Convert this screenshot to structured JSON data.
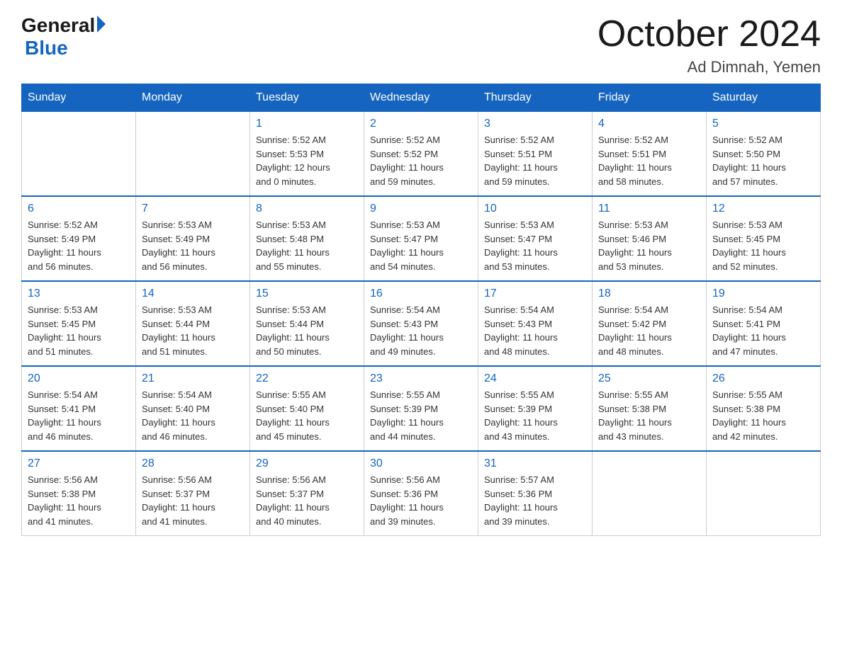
{
  "header": {
    "logo_general": "General",
    "logo_blue": "Blue",
    "month_title": "October 2024",
    "location": "Ad Dimnah, Yemen"
  },
  "weekdays": [
    "Sunday",
    "Monday",
    "Tuesday",
    "Wednesday",
    "Thursday",
    "Friday",
    "Saturday"
  ],
  "weeks": [
    [
      {
        "day": "",
        "info": ""
      },
      {
        "day": "",
        "info": ""
      },
      {
        "day": "1",
        "info": "Sunrise: 5:52 AM\nSunset: 5:53 PM\nDaylight: 12 hours\nand 0 minutes."
      },
      {
        "day": "2",
        "info": "Sunrise: 5:52 AM\nSunset: 5:52 PM\nDaylight: 11 hours\nand 59 minutes."
      },
      {
        "day": "3",
        "info": "Sunrise: 5:52 AM\nSunset: 5:51 PM\nDaylight: 11 hours\nand 59 minutes."
      },
      {
        "day": "4",
        "info": "Sunrise: 5:52 AM\nSunset: 5:51 PM\nDaylight: 11 hours\nand 58 minutes."
      },
      {
        "day": "5",
        "info": "Sunrise: 5:52 AM\nSunset: 5:50 PM\nDaylight: 11 hours\nand 57 minutes."
      }
    ],
    [
      {
        "day": "6",
        "info": "Sunrise: 5:52 AM\nSunset: 5:49 PM\nDaylight: 11 hours\nand 56 minutes."
      },
      {
        "day": "7",
        "info": "Sunrise: 5:53 AM\nSunset: 5:49 PM\nDaylight: 11 hours\nand 56 minutes."
      },
      {
        "day": "8",
        "info": "Sunrise: 5:53 AM\nSunset: 5:48 PM\nDaylight: 11 hours\nand 55 minutes."
      },
      {
        "day": "9",
        "info": "Sunrise: 5:53 AM\nSunset: 5:47 PM\nDaylight: 11 hours\nand 54 minutes."
      },
      {
        "day": "10",
        "info": "Sunrise: 5:53 AM\nSunset: 5:47 PM\nDaylight: 11 hours\nand 53 minutes."
      },
      {
        "day": "11",
        "info": "Sunrise: 5:53 AM\nSunset: 5:46 PM\nDaylight: 11 hours\nand 53 minutes."
      },
      {
        "day": "12",
        "info": "Sunrise: 5:53 AM\nSunset: 5:45 PM\nDaylight: 11 hours\nand 52 minutes."
      }
    ],
    [
      {
        "day": "13",
        "info": "Sunrise: 5:53 AM\nSunset: 5:45 PM\nDaylight: 11 hours\nand 51 minutes."
      },
      {
        "day": "14",
        "info": "Sunrise: 5:53 AM\nSunset: 5:44 PM\nDaylight: 11 hours\nand 51 minutes."
      },
      {
        "day": "15",
        "info": "Sunrise: 5:53 AM\nSunset: 5:44 PM\nDaylight: 11 hours\nand 50 minutes."
      },
      {
        "day": "16",
        "info": "Sunrise: 5:54 AM\nSunset: 5:43 PM\nDaylight: 11 hours\nand 49 minutes."
      },
      {
        "day": "17",
        "info": "Sunrise: 5:54 AM\nSunset: 5:43 PM\nDaylight: 11 hours\nand 48 minutes."
      },
      {
        "day": "18",
        "info": "Sunrise: 5:54 AM\nSunset: 5:42 PM\nDaylight: 11 hours\nand 48 minutes."
      },
      {
        "day": "19",
        "info": "Sunrise: 5:54 AM\nSunset: 5:41 PM\nDaylight: 11 hours\nand 47 minutes."
      }
    ],
    [
      {
        "day": "20",
        "info": "Sunrise: 5:54 AM\nSunset: 5:41 PM\nDaylight: 11 hours\nand 46 minutes."
      },
      {
        "day": "21",
        "info": "Sunrise: 5:54 AM\nSunset: 5:40 PM\nDaylight: 11 hours\nand 46 minutes."
      },
      {
        "day": "22",
        "info": "Sunrise: 5:55 AM\nSunset: 5:40 PM\nDaylight: 11 hours\nand 45 minutes."
      },
      {
        "day": "23",
        "info": "Sunrise: 5:55 AM\nSunset: 5:39 PM\nDaylight: 11 hours\nand 44 minutes."
      },
      {
        "day": "24",
        "info": "Sunrise: 5:55 AM\nSunset: 5:39 PM\nDaylight: 11 hours\nand 43 minutes."
      },
      {
        "day": "25",
        "info": "Sunrise: 5:55 AM\nSunset: 5:38 PM\nDaylight: 11 hours\nand 43 minutes."
      },
      {
        "day": "26",
        "info": "Sunrise: 5:55 AM\nSunset: 5:38 PM\nDaylight: 11 hours\nand 42 minutes."
      }
    ],
    [
      {
        "day": "27",
        "info": "Sunrise: 5:56 AM\nSunset: 5:38 PM\nDaylight: 11 hours\nand 41 minutes."
      },
      {
        "day": "28",
        "info": "Sunrise: 5:56 AM\nSunset: 5:37 PM\nDaylight: 11 hours\nand 41 minutes."
      },
      {
        "day": "29",
        "info": "Sunrise: 5:56 AM\nSunset: 5:37 PM\nDaylight: 11 hours\nand 40 minutes."
      },
      {
        "day": "30",
        "info": "Sunrise: 5:56 AM\nSunset: 5:36 PM\nDaylight: 11 hours\nand 39 minutes."
      },
      {
        "day": "31",
        "info": "Sunrise: 5:57 AM\nSunset: 5:36 PM\nDaylight: 11 hours\nand 39 minutes."
      },
      {
        "day": "",
        "info": ""
      },
      {
        "day": "",
        "info": ""
      }
    ]
  ]
}
